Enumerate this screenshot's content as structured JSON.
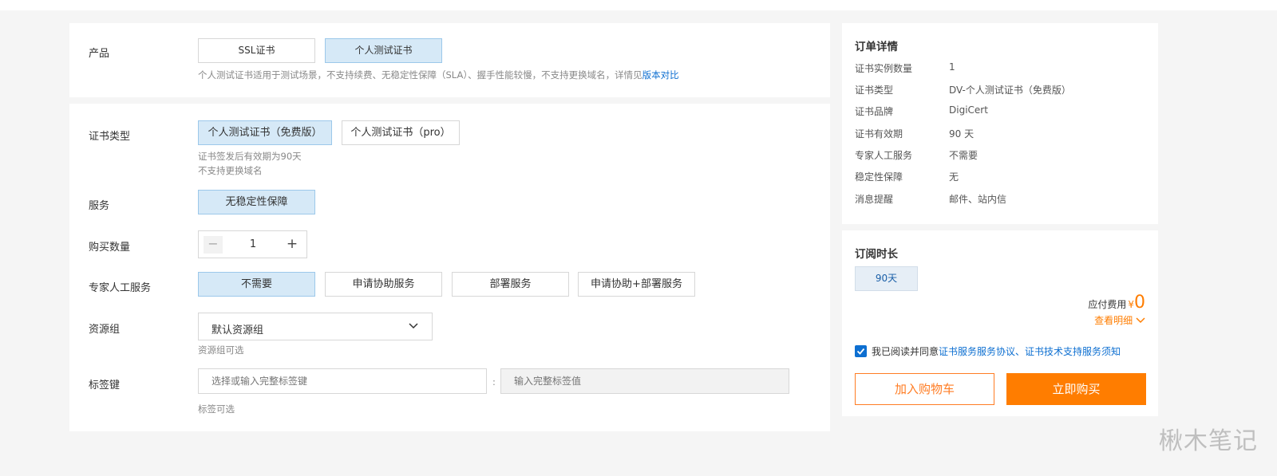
{
  "product": {
    "label": "产品",
    "options": [
      "SSL证书",
      "个人测试证书"
    ],
    "hint_text": "个人测试证书适用于测试场景，不支持续费、无稳定性保障（SLA）、握手性能较慢，不支持更换域名，详情见",
    "hint_link": "版本对比"
  },
  "cert_type": {
    "label": "证书类型",
    "options": [
      "个人测试证书（免费版）",
      "个人测试证书（pro）"
    ],
    "hint_line1": "证书签发后有效期为90天",
    "hint_line2": "不支持更换域名"
  },
  "service": {
    "label": "服务",
    "option": "无稳定性保障"
  },
  "quantity": {
    "label": "购买数量",
    "value": "1",
    "minus": "−",
    "plus": "+"
  },
  "expert": {
    "label": "专家人工服务",
    "options": [
      "不需要",
      "申请协助服务",
      "部署服务",
      "申请协助+部署服务"
    ]
  },
  "resource_group": {
    "label": "资源组",
    "value": "默认资源组",
    "hint": "资源组可选"
  },
  "tag": {
    "label": "标签键",
    "key_placeholder": "选择或输入完整标签键",
    "separator": ":",
    "value_placeholder": "输入完整标签值",
    "hint": "标签可选"
  },
  "order": {
    "title": "订单详情",
    "rows": [
      {
        "k": "证书实例数量",
        "v": "1"
      },
      {
        "k": "证书类型",
        "v": "DV-个人测试证书（免费版）"
      },
      {
        "k": "证书品牌",
        "v": "DigiCert"
      },
      {
        "k": "证书有效期",
        "v": "90 天"
      },
      {
        "k": "专家人工服务",
        "v": "不需要"
      },
      {
        "k": "稳定性保障",
        "v": "无"
      },
      {
        "k": "消息提醒",
        "v": "邮件、站内信"
      }
    ]
  },
  "subscription": {
    "title": "订阅时长",
    "option": "90天",
    "fee_label": "应付费用",
    "currency": "¥",
    "fee_value": "0",
    "detail_link": "查看明细",
    "agree_prefix": "我已阅读并同意",
    "agree_link1": "证书服务服务协议",
    "agree_sep": "、",
    "agree_link2": "证书技术支持服务须知",
    "add_to_cart": "加入购物车",
    "buy_now": "立即购买"
  },
  "watermark": "楸木笔记",
  "colors": {
    "accent_orange": "#ff7d00",
    "selected_bg": "#d6e9f7",
    "link_blue": "#0d6fd1"
  }
}
